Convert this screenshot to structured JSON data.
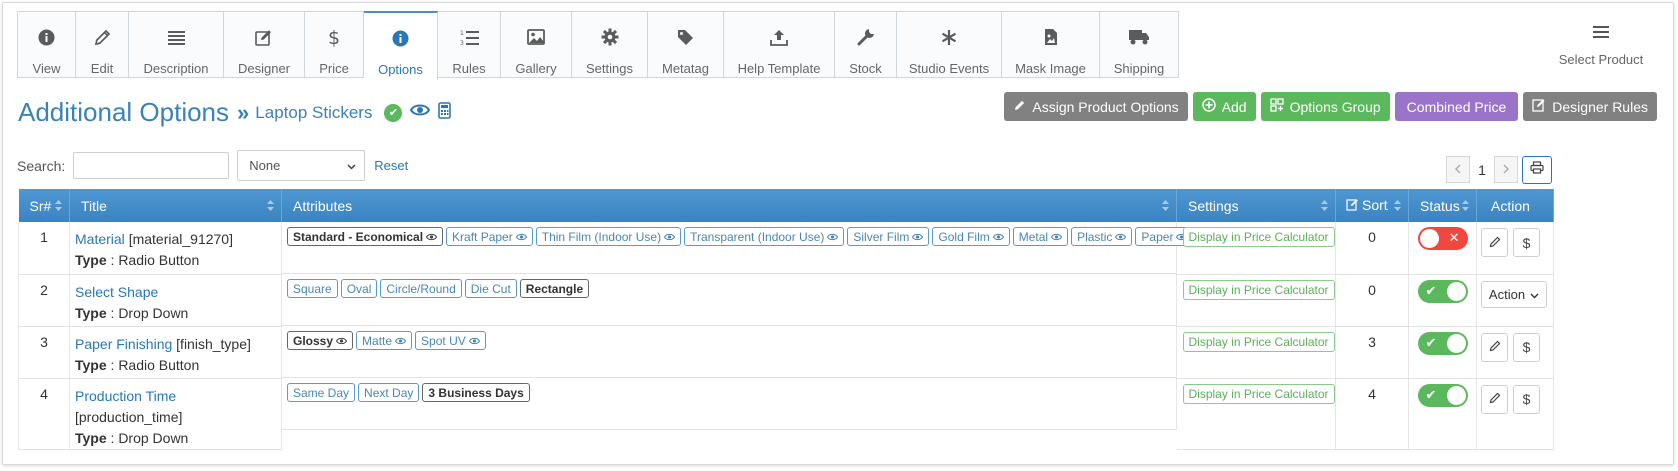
{
  "tabs": [
    {
      "label": "View",
      "icon": "info-icon"
    },
    {
      "label": "Edit",
      "icon": "pencil-icon"
    },
    {
      "label": "Description",
      "icon": "list-icon"
    },
    {
      "label": "Designer",
      "icon": "edit-icon"
    },
    {
      "label": "Price",
      "icon": "dollar-icon"
    },
    {
      "label": "Options",
      "icon": "info-icon",
      "active": true
    },
    {
      "label": "Rules",
      "icon": "numbered-list-icon"
    },
    {
      "label": "Gallery",
      "icon": "image-icon"
    },
    {
      "label": "Settings",
      "icon": "gear-icon"
    },
    {
      "label": "Metatag",
      "icon": "tag-icon"
    },
    {
      "label": "Help Template",
      "icon": "upload-icon"
    },
    {
      "label": "Stock",
      "icon": "wrench-icon"
    },
    {
      "label": "Studio Events",
      "icon": "asterisk-icon"
    },
    {
      "label": "Mask Image",
      "icon": "file-image-icon"
    },
    {
      "label": "Shipping",
      "icon": "truck-icon"
    }
  ],
  "select_product": "Select Product",
  "heading": {
    "title": "Additional Options",
    "separator": "»",
    "product": "Laptop Stickers"
  },
  "top_buttons": {
    "assign": "Assign Product Options",
    "add": "Add",
    "options_group": "Options Group",
    "combined_price": "Combined Price",
    "designer_rules": "Designer Rules"
  },
  "search": {
    "label": "Search:",
    "value": "",
    "filter_selected": "None",
    "reset": "Reset"
  },
  "pagination": {
    "current": "1"
  },
  "table": {
    "headers": {
      "sr": "Sr#",
      "title": "Title",
      "attributes": "Attributes",
      "settings": "Settings",
      "sort": "Sort",
      "status": "Status",
      "action": "Action"
    },
    "type_label": "Type",
    "rows": [
      {
        "sr": "1",
        "title": "Material",
        "code": "[material_91270]",
        "type": "Radio Button",
        "attributes": [
          {
            "label": "Standard - Economical",
            "default": true,
            "eye": true
          },
          {
            "label": "Kraft Paper",
            "eye": true
          },
          {
            "label": "Thin Film (Indoor Use)",
            "eye": true
          },
          {
            "label": "Transparent (Indoor Use)",
            "eye": true
          },
          {
            "label": "Silver Film",
            "eye": true
          },
          {
            "label": "Gold Film",
            "eye": true
          },
          {
            "label": "Metal",
            "eye": true
          },
          {
            "label": "Plastic",
            "eye": true
          },
          {
            "label": "Paper",
            "eye": true
          }
        ],
        "setting": "Display in Price Calculator",
        "sort": "0",
        "status": "off",
        "action": "buttons"
      },
      {
        "sr": "2",
        "title": "Select Shape",
        "code": "",
        "type": "Drop Down",
        "attributes": [
          {
            "label": "Square"
          },
          {
            "label": "Oval"
          },
          {
            "label": "Circle/Round"
          },
          {
            "label": "Die Cut"
          },
          {
            "label": "Rectangle",
            "default": true
          }
        ],
        "setting": "Display in Price Calculator",
        "sort": "0",
        "status": "on",
        "action": "dropdown",
        "action_label": "Action"
      },
      {
        "sr": "3",
        "title": "Paper Finishing",
        "code": "[finish_type]",
        "type": "Radio Button",
        "attributes": [
          {
            "label": "Glossy",
            "default": true,
            "eye": true
          },
          {
            "label": "Matte",
            "eye": true
          },
          {
            "label": "Spot UV",
            "eye": true
          }
        ],
        "setting": "Display in Price Calculator",
        "sort": "3",
        "status": "on",
        "action": "buttons"
      },
      {
        "sr": "4",
        "title": "Production Time",
        "code": "[production_time]",
        "type": "Drop Down",
        "attributes": [
          {
            "label": "Same Day"
          },
          {
            "label": "Next Day"
          },
          {
            "label": "3 Business Days",
            "default": true
          }
        ],
        "setting": "Display in Price Calculator",
        "sort": "4",
        "status": "on",
        "action": "buttons"
      }
    ]
  }
}
